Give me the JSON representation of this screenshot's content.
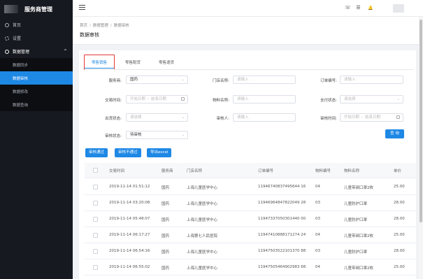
{
  "sidebar": {
    "title": "服务商管理",
    "items": [
      {
        "label": "首页"
      },
      {
        "label": "设置"
      },
      {
        "label": "数据管理",
        "chevron": "^"
      }
    ],
    "submenu": [
      {
        "label": "数据同步"
      },
      {
        "label": "数据审核"
      },
      {
        "label": "数据修改"
      },
      {
        "label": "数据查询"
      }
    ]
  },
  "header": {
    "icons": [
      "phone-icon",
      "menu-list-icon",
      "bell-icon"
    ],
    "phone_glyph": "☏",
    "list_glyph": "☰",
    "bell_glyph": "🔔"
  },
  "breadcrumb": {
    "items": [
      "首页",
      "数据管理",
      "数据审核"
    ],
    "sep": "/"
  },
  "page_title": "数据审核",
  "tabs": [
    {
      "label": "零售销售"
    },
    {
      "label": "零售配货"
    },
    {
      "label": "零售退货"
    }
  ],
  "filters": {
    "provider": {
      "label": "服务商:",
      "value": "国药"
    },
    "store": {
      "label": "门店名称:",
      "placeholder": "请输入"
    },
    "order_no": {
      "label": "订单编号:",
      "placeholder": "请输入"
    },
    "trade_time": {
      "label": "交易时间:",
      "start": "开始日期",
      "end": "结束日期",
      "dash": "-"
    },
    "item_name": {
      "label": "物料名称:",
      "placeholder": "请输入"
    },
    "pay_status": {
      "label": "支付状态:",
      "placeholder": "请选择"
    },
    "out_status": {
      "label": "出货状态:",
      "placeholder": "请选择"
    },
    "auditor": {
      "label": "审核人:",
      "placeholder": "请输入"
    },
    "audit_time": {
      "label": "审核时间:",
      "start": "开始日期",
      "end": "结束日期",
      "dash": "-"
    },
    "audit_status": {
      "label": "审核状态:",
      "value": "待审核"
    }
  },
  "search_button": "查 询",
  "actions": {
    "approve": "审核通过",
    "reject": "审核不通过",
    "export": "导出excel"
  },
  "table": {
    "columns": [
      "交易时间",
      "服务商",
      "门店名称",
      "订单编号",
      "物料编号",
      "物料名称",
      "单价"
    ],
    "rows": [
      [
        "2019-11-14 01:51:12",
        "国药",
        "上海儿童医学中心",
        "11946740837495644 16",
        "04",
        "儿童带阀口罩2枚",
        "25.00"
      ],
      [
        "2019-11-14 03:20:08",
        "国药",
        "上海儿童医学中心",
        "11946964847822049 28",
        "03",
        "儿童防护口罩",
        "28.00"
      ],
      [
        "2019-11-14 05:48:07",
        "国药",
        "上海儿童医学中心",
        "11947337050301440 00",
        "03",
        "儿童防护口罩",
        "28.00"
      ],
      [
        "2019-11-14 06:17:27",
        "国药",
        "上海第七人民医院",
        "11947410888171274 24",
        "04",
        "儿童带阀口罩2枚",
        "25.00"
      ],
      [
        "2019-11-14 06:54:16",
        "国药",
        "上海儿童医学中心",
        "11947503522101370 88",
        "03",
        "儿童防护口罩",
        "28.00"
      ],
      [
        "2019-11-14 06:55:02",
        "国药",
        "上海儿童医学中心",
        "11947505464902983 68",
        "04",
        "儿童带阀口罩2枚",
        "25.00"
      ]
    ]
  },
  "colors": {
    "accent": "#1e88e5",
    "sidebar": "#16191f",
    "highlight": "#e53935"
  }
}
